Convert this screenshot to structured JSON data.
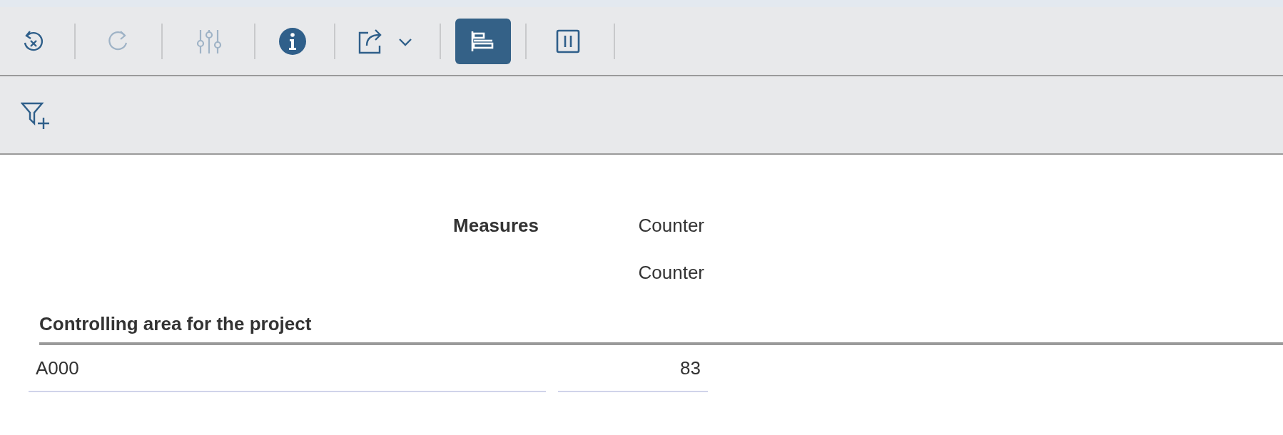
{
  "toolbar": [
    {
      "kind": "reset",
      "disabled": false,
      "selected": false
    },
    {
      "kind": "redo",
      "disabled": true,
      "selected": false
    },
    {
      "kind": "settings",
      "disabled": true,
      "selected": false
    },
    {
      "kind": "info",
      "disabled": false,
      "selected": false
    },
    {
      "kind": "export",
      "disabled": false,
      "selected": false
    },
    {
      "kind": "table",
      "disabled": false,
      "selected": true
    },
    {
      "kind": "pause",
      "disabled": false,
      "selected": false
    }
  ],
  "filter_bar": {
    "kind": "add-filter"
  },
  "table": {
    "measures_label": "Measures",
    "measure_headers": [
      "Counter",
      "Counter"
    ],
    "dimension_header": "Controlling area for the project",
    "rows": [
      {
        "dimension": "A000",
        "values": [
          "83"
        ]
      }
    ]
  }
}
